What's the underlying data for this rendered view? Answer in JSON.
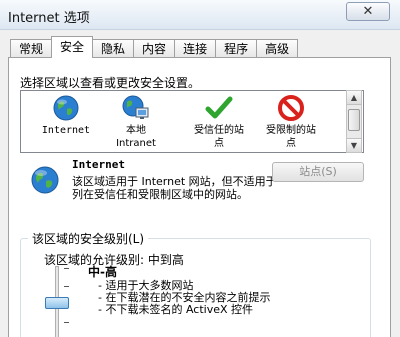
{
  "window": {
    "title": "Internet 选项",
    "close_glyph": "✕"
  },
  "tabs": [
    {
      "label": "常规"
    },
    {
      "label": "安全"
    },
    {
      "label": "隐私"
    },
    {
      "label": "内容"
    },
    {
      "label": "连接"
    },
    {
      "label": "程序"
    },
    {
      "label": "高级"
    }
  ],
  "security": {
    "instruction": "选择区域以查看或更改安全设置。",
    "zones": [
      {
        "label": "Internet",
        "icon": "globe-icon"
      },
      {
        "label": "本地\nIntranet",
        "icon": "intranet-icon"
      },
      {
        "label": "受信任的站\n点",
        "icon": "checkmark-icon"
      },
      {
        "label": "受限制的站\n点",
        "icon": "prohibited-icon"
      }
    ],
    "selected_zone": {
      "name": "Internet",
      "description": "该区域适用于 Internet 网站，但不适用于列在受信任和受限制区域中的网站。"
    },
    "sites_button": "站点(S)",
    "level_group": {
      "legend": "该区域的安全级别(L)",
      "allowed": "该区域的允许级别: 中到高",
      "level_name": "中-高",
      "slider_position": 0.5,
      "bullets": [
        "适用于大多数网站",
        "在下载潜在的不安全内容之前提示",
        "不下载未签名的 ActiveX 控件"
      ]
    }
  },
  "colors": {
    "accent": "#3a7bb5",
    "check": "#2fa52f",
    "prohibit": "#d9221c",
    "globe": "#2b7fd0"
  }
}
